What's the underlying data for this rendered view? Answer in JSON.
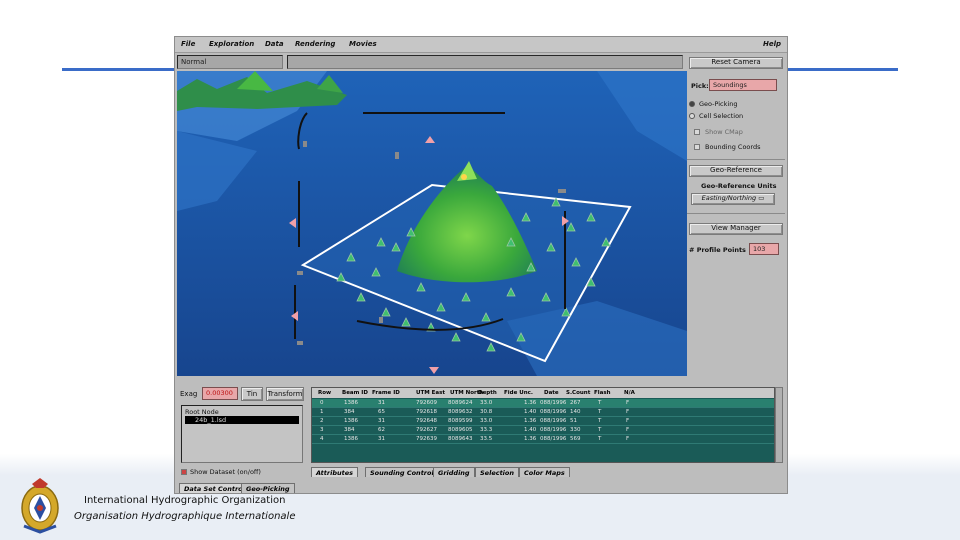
{
  "app": {
    "menu": [
      "File",
      "Exploration",
      "Data",
      "Rendering",
      "Movies",
      "Help"
    ],
    "status_field": "Normal",
    "status_message": ""
  },
  "right_panel": {
    "reset_camera": "Reset Camera",
    "pick_label": "Pick:",
    "pick_value": "Soundings",
    "geo_picking": "Geo-Picking",
    "cell_selection": "Cell Selection",
    "show_cmap": "Show CMap",
    "bounding_coords": "Bounding Coords",
    "geo_reference": "Geo-Reference",
    "geo_reference_units": "Geo-Reference Units",
    "easting_northing": "Easting/Northing",
    "view_manager": "View Manager",
    "profile_points_label": "# Profile Points",
    "profile_points_value": "103"
  },
  "bottom_left": {
    "exag_label": "Exag",
    "exag_value": "0.00300",
    "tin": "Tin",
    "transform": "Transform",
    "root_node": "Root Node",
    "dataset_item": "24b_1.lsd",
    "show_dataset": "Show Dataset (on/off)",
    "tab_data_set_control": "Data Set Control",
    "tab_geo_picking": "Geo-Picking"
  },
  "table": {
    "headers": [
      "Row",
      "Beam ID",
      "Frame ID",
      "UTM East",
      "UTM North",
      "Depth",
      "Fide Unc.",
      "Date",
      "S.Count",
      "Flash",
      "N/A"
    ],
    "rows": [
      [
        "0",
        "1386",
        "31",
        "792609",
        "8089624",
        "33.0",
        "1.36",
        "088/1996",
        "267",
        "T",
        "F"
      ],
      [
        "1",
        "384",
        "65",
        "792618",
        "8089632",
        "30.8",
        "1.40",
        "088/1996",
        "140",
        "T",
        "F"
      ],
      [
        "2",
        "1386",
        "31",
        "792648",
        "8089599",
        "33.0",
        "1.36",
        "088/1996",
        "51",
        "T",
        "F"
      ],
      [
        "3",
        "384",
        "62",
        "792627",
        "8089605",
        "33.3",
        "1.40",
        "088/1996",
        "330",
        "T",
        "F"
      ],
      [
        "4",
        "1386",
        "31",
        "792639",
        "8089643",
        "33.5",
        "1.36",
        "088/1996",
        "569",
        "T",
        "F"
      ]
    ],
    "tabs": [
      "Attributes",
      "Sounding Control",
      "Gridding",
      "Selection",
      "Color Maps"
    ]
  },
  "footer": {
    "org_en": "International Hydrographic Organization",
    "org_fr": "Organisation Hydrographique Internationale"
  },
  "colors": {
    "accent_rule": "#3a6cc8",
    "pick_field": "#e8a7a9",
    "table_bg": "#1a5b57"
  }
}
